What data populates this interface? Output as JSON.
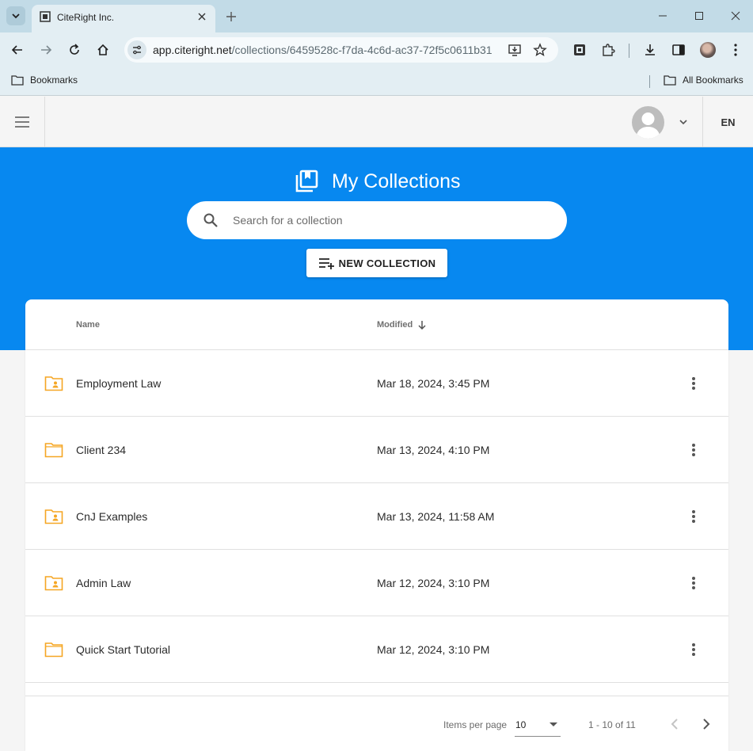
{
  "browser": {
    "tab_title": "CiteRight Inc.",
    "url_host": "app.citeright.net",
    "url_path": "/collections/6459528c-f7da-4c6d-ac37-72f5c0611b31",
    "bookmarks_label": "Bookmarks",
    "all_bookmarks_label": "All Bookmarks"
  },
  "header": {
    "language": "EN"
  },
  "hero": {
    "title": "My Collections",
    "search_placeholder": "Search for a collection",
    "new_collection_label": "NEW COLLECTION"
  },
  "table": {
    "columns": {
      "name": "Name",
      "modified": "Modified"
    },
    "sort": {
      "column": "Modified",
      "direction": "descending"
    },
    "rows": [
      {
        "name": "Employment Law",
        "modified": "Mar 18, 2024, 3:45 PM",
        "icon": "shared-folder-icon"
      },
      {
        "name": "Client 234",
        "modified": "Mar 13, 2024, 4:10 PM",
        "icon": "folder-icon"
      },
      {
        "name": "CnJ Examples",
        "modified": "Mar 13, 2024, 11:58 AM",
        "icon": "shared-folder-icon"
      },
      {
        "name": "Admin Law",
        "modified": "Mar 12, 2024, 3:10 PM",
        "icon": "shared-folder-icon"
      },
      {
        "name": "Quick Start Tutorial",
        "modified": "Mar 12, 2024, 3:10 PM",
        "icon": "folder-icon"
      }
    ]
  },
  "pagination": {
    "items_per_page_label": "Items per page",
    "items_per_page": "10",
    "range": "1 - 10 of 11"
  },
  "colors": {
    "brand_blue": "#0788f0",
    "folder_orange": "#f5a623",
    "tab_strip": "#c2dbe7"
  }
}
